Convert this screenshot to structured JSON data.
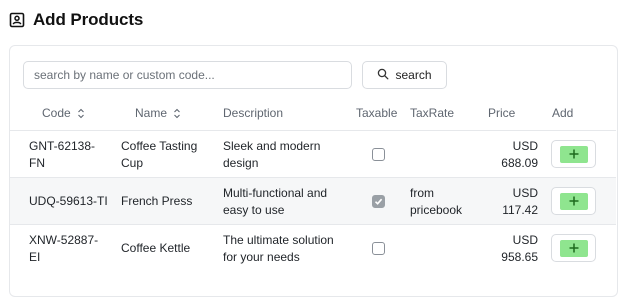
{
  "page": {
    "title": "Add Products",
    "title_icon": "contact-card-icon"
  },
  "search": {
    "placeholder": "search by name or custom code...",
    "value": "",
    "button_label": "search",
    "button_icon": "search-icon"
  },
  "table": {
    "columns": {
      "code": "Code",
      "name": "Name",
      "description": "Description",
      "taxable": "Taxable",
      "taxrate": "TaxRate",
      "price": "Price",
      "add": "Add"
    },
    "rows": [
      {
        "code_line1": "GNT-62138-",
        "code_line2": "FN",
        "name_line1": "Coffee Tasting",
        "name_line2": "Cup",
        "desc_line1": "Sleek and modern",
        "desc_line2": "design",
        "taxable": false,
        "taxrate_line1": "",
        "taxrate_line2": "",
        "currency": "USD",
        "amount": "688.09"
      },
      {
        "code_line1": "UDQ-59613-TI",
        "code_line2": "",
        "name_line1": "French Press",
        "name_line2": "",
        "desc_line1": "Multi-functional and",
        "desc_line2": "easy to use",
        "taxable": true,
        "taxrate_line1": "from",
        "taxrate_line2": "pricebook",
        "currency": "USD",
        "amount": "117.42"
      },
      {
        "code_line1": "XNW-52887-",
        "code_line2": "EI",
        "name_line1": "Coffee Kettle",
        "name_line2": "",
        "desc_line1": "The ultimate solution",
        "desc_line2": "for your needs",
        "taxable": false,
        "taxrate_line1": "",
        "taxrate_line2": "",
        "currency": "USD",
        "amount": "958.65"
      }
    ]
  },
  "colors": {
    "add_button_fill": "#8fe58f",
    "row_alt_background": "#f6f7f8",
    "checkbox_checked": "#9aa0a6"
  }
}
